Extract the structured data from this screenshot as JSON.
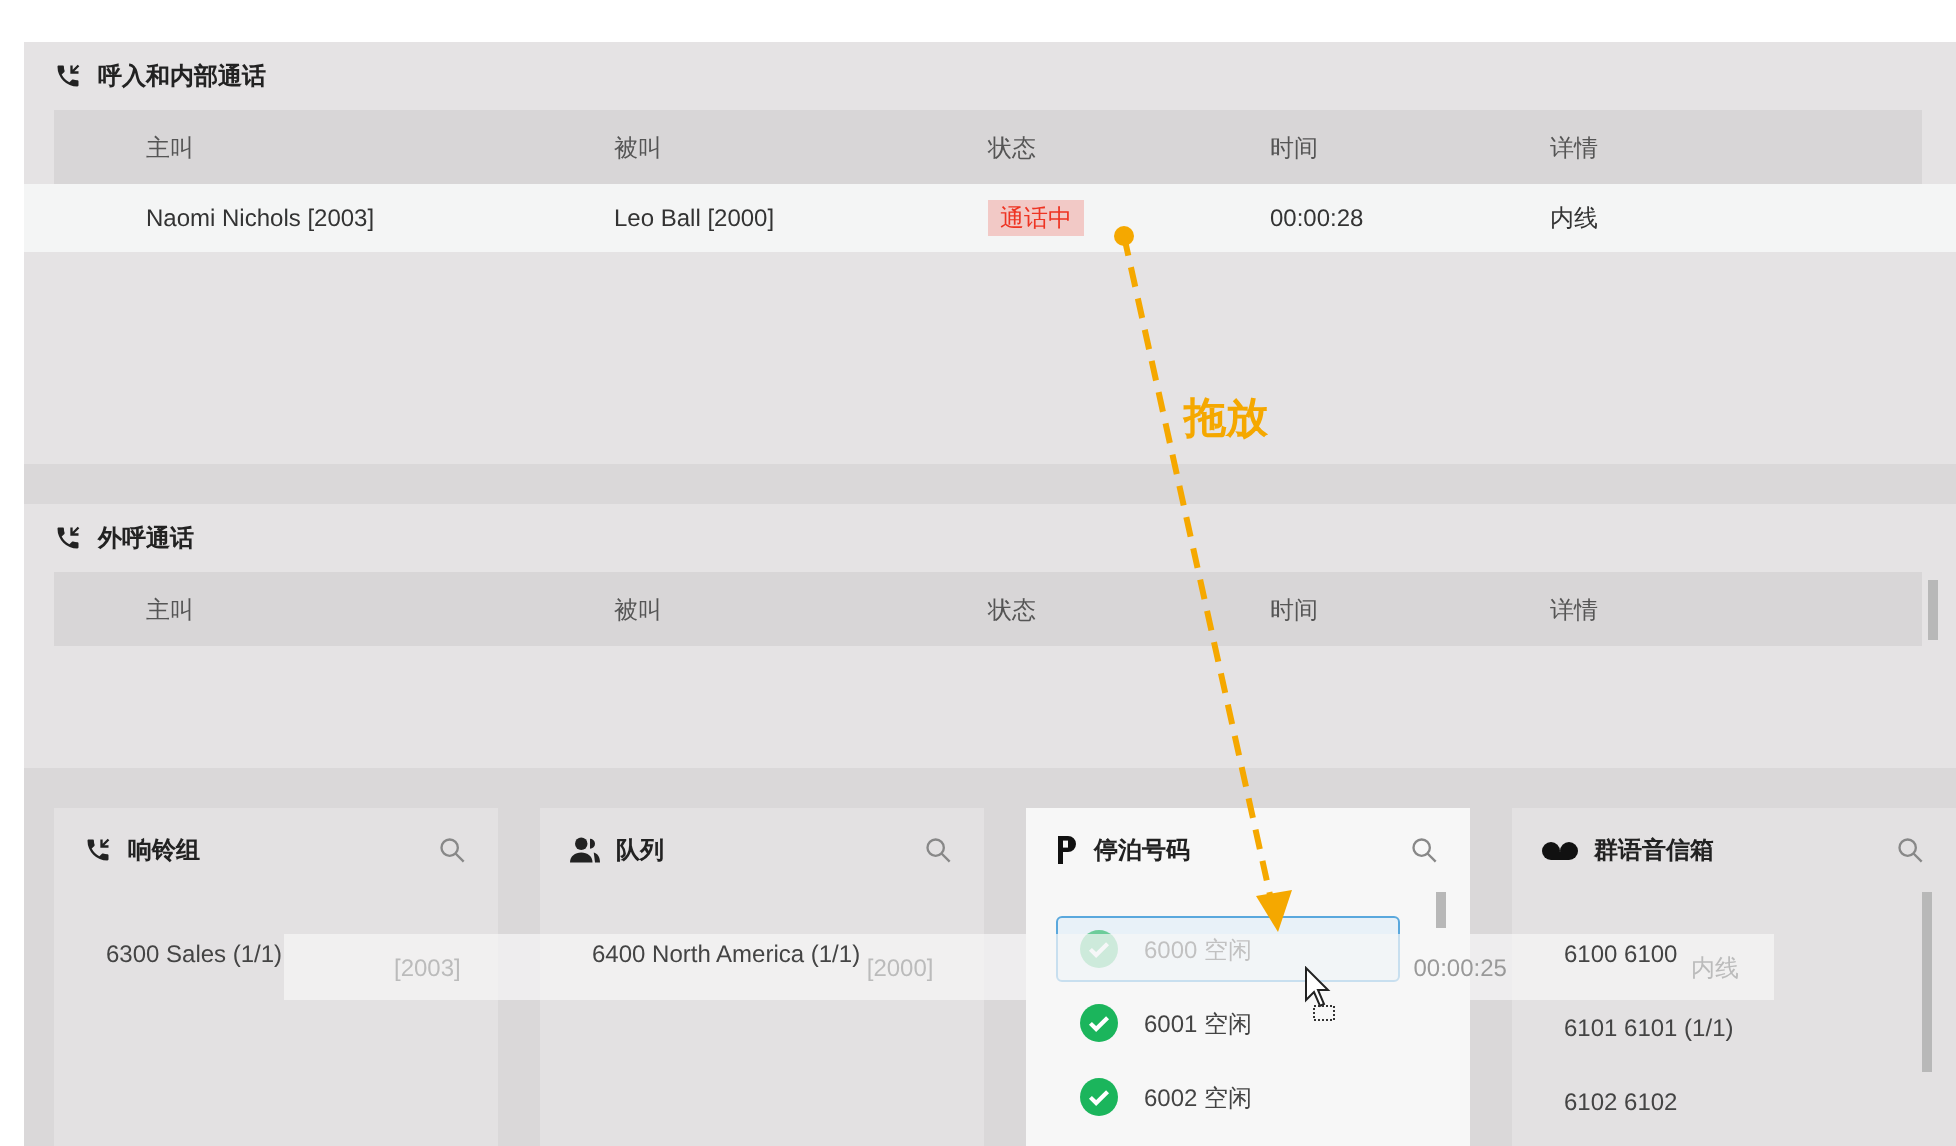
{
  "inbound": {
    "title": "呼入和内部通话",
    "columns": [
      "主叫",
      "被叫",
      "状态",
      "时间",
      "详情"
    ],
    "rows": [
      {
        "caller": "Naomi Nichols [2003]",
        "callee": "Leo Ball [2000]",
        "status": "通话中",
        "time": "00:00:28",
        "detail": "内线"
      }
    ]
  },
  "outbound": {
    "title": "外呼通话",
    "columns": [
      "主叫",
      "被叫",
      "状态",
      "时间",
      "详情"
    ]
  },
  "panels": [
    {
      "kind": "ring_group",
      "title": "响铃组",
      "highlighted": false,
      "items": [
        {
          "text": "6300 Sales (1/1)"
        }
      ]
    },
    {
      "kind": "queue",
      "title": "队列",
      "highlighted": false,
      "items": [
        {
          "text": "6400 North America (1/1)"
        }
      ]
    },
    {
      "kind": "parking",
      "title": "停泊号码",
      "highlighted": true,
      "items": [
        {
          "text": "6000 空闲",
          "selected": true
        },
        {
          "text": "6001 空闲",
          "selected": false
        },
        {
          "text": "6002 空闲",
          "selected": false
        }
      ]
    },
    {
      "kind": "voicemail",
      "title": "群语音信箱",
      "highlighted": false,
      "items": [
        {
          "text": "6100 6100"
        },
        {
          "text": "6101 6101 (1/1)"
        },
        {
          "text": "6102 6102"
        }
      ]
    }
  ],
  "drag_ghost": {
    "caller": "[2003]",
    "callee": "[2000]",
    "time": "00:00:25",
    "detail": "内线"
  },
  "annotation": {
    "label": "拖放"
  }
}
